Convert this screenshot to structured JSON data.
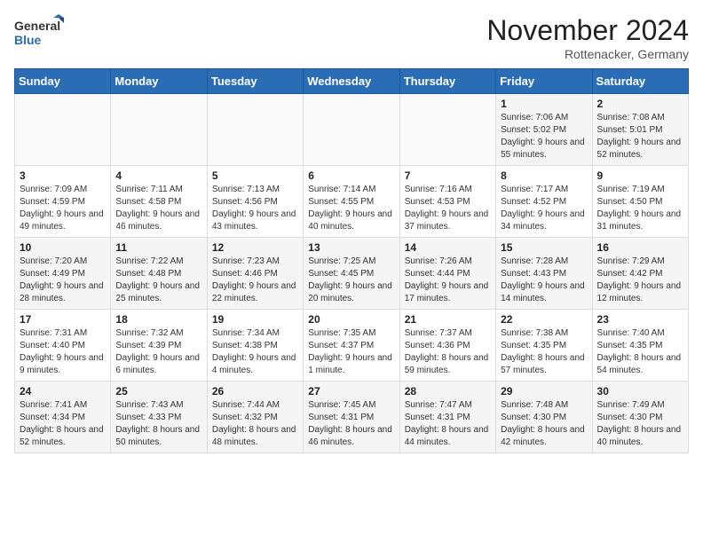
{
  "logo": {
    "general": "General",
    "blue": "Blue"
  },
  "title": "November 2024",
  "location": "Rottenacker, Germany",
  "days_header": [
    "Sunday",
    "Monday",
    "Tuesday",
    "Wednesday",
    "Thursday",
    "Friday",
    "Saturday"
  ],
  "weeks": [
    [
      {
        "day": "",
        "info": ""
      },
      {
        "day": "",
        "info": ""
      },
      {
        "day": "",
        "info": ""
      },
      {
        "day": "",
        "info": ""
      },
      {
        "day": "",
        "info": ""
      },
      {
        "day": "1",
        "info": "Sunrise: 7:06 AM\nSunset: 5:02 PM\nDaylight: 9 hours and 55 minutes."
      },
      {
        "day": "2",
        "info": "Sunrise: 7:08 AM\nSunset: 5:01 PM\nDaylight: 9 hours and 52 minutes."
      }
    ],
    [
      {
        "day": "3",
        "info": "Sunrise: 7:09 AM\nSunset: 4:59 PM\nDaylight: 9 hours and 49 minutes."
      },
      {
        "day": "4",
        "info": "Sunrise: 7:11 AM\nSunset: 4:58 PM\nDaylight: 9 hours and 46 minutes."
      },
      {
        "day": "5",
        "info": "Sunrise: 7:13 AM\nSunset: 4:56 PM\nDaylight: 9 hours and 43 minutes."
      },
      {
        "day": "6",
        "info": "Sunrise: 7:14 AM\nSunset: 4:55 PM\nDaylight: 9 hours and 40 minutes."
      },
      {
        "day": "7",
        "info": "Sunrise: 7:16 AM\nSunset: 4:53 PM\nDaylight: 9 hours and 37 minutes."
      },
      {
        "day": "8",
        "info": "Sunrise: 7:17 AM\nSunset: 4:52 PM\nDaylight: 9 hours and 34 minutes."
      },
      {
        "day": "9",
        "info": "Sunrise: 7:19 AM\nSunset: 4:50 PM\nDaylight: 9 hours and 31 minutes."
      }
    ],
    [
      {
        "day": "10",
        "info": "Sunrise: 7:20 AM\nSunset: 4:49 PM\nDaylight: 9 hours and 28 minutes."
      },
      {
        "day": "11",
        "info": "Sunrise: 7:22 AM\nSunset: 4:48 PM\nDaylight: 9 hours and 25 minutes."
      },
      {
        "day": "12",
        "info": "Sunrise: 7:23 AM\nSunset: 4:46 PM\nDaylight: 9 hours and 22 minutes."
      },
      {
        "day": "13",
        "info": "Sunrise: 7:25 AM\nSunset: 4:45 PM\nDaylight: 9 hours and 20 minutes."
      },
      {
        "day": "14",
        "info": "Sunrise: 7:26 AM\nSunset: 4:44 PM\nDaylight: 9 hours and 17 minutes."
      },
      {
        "day": "15",
        "info": "Sunrise: 7:28 AM\nSunset: 4:43 PM\nDaylight: 9 hours and 14 minutes."
      },
      {
        "day": "16",
        "info": "Sunrise: 7:29 AM\nSunset: 4:42 PM\nDaylight: 9 hours and 12 minutes."
      }
    ],
    [
      {
        "day": "17",
        "info": "Sunrise: 7:31 AM\nSunset: 4:40 PM\nDaylight: 9 hours and 9 minutes."
      },
      {
        "day": "18",
        "info": "Sunrise: 7:32 AM\nSunset: 4:39 PM\nDaylight: 9 hours and 6 minutes."
      },
      {
        "day": "19",
        "info": "Sunrise: 7:34 AM\nSunset: 4:38 PM\nDaylight: 9 hours and 4 minutes."
      },
      {
        "day": "20",
        "info": "Sunrise: 7:35 AM\nSunset: 4:37 PM\nDaylight: 9 hours and 1 minute."
      },
      {
        "day": "21",
        "info": "Sunrise: 7:37 AM\nSunset: 4:36 PM\nDaylight: 8 hours and 59 minutes."
      },
      {
        "day": "22",
        "info": "Sunrise: 7:38 AM\nSunset: 4:35 PM\nDaylight: 8 hours and 57 minutes."
      },
      {
        "day": "23",
        "info": "Sunrise: 7:40 AM\nSunset: 4:35 PM\nDaylight: 8 hours and 54 minutes."
      }
    ],
    [
      {
        "day": "24",
        "info": "Sunrise: 7:41 AM\nSunset: 4:34 PM\nDaylight: 8 hours and 52 minutes."
      },
      {
        "day": "25",
        "info": "Sunrise: 7:43 AM\nSunset: 4:33 PM\nDaylight: 8 hours and 50 minutes."
      },
      {
        "day": "26",
        "info": "Sunrise: 7:44 AM\nSunset: 4:32 PM\nDaylight: 8 hours and 48 minutes."
      },
      {
        "day": "27",
        "info": "Sunrise: 7:45 AM\nSunset: 4:31 PM\nDaylight: 8 hours and 46 minutes."
      },
      {
        "day": "28",
        "info": "Sunrise: 7:47 AM\nSunset: 4:31 PM\nDaylight: 8 hours and 44 minutes."
      },
      {
        "day": "29",
        "info": "Sunrise: 7:48 AM\nSunset: 4:30 PM\nDaylight: 8 hours and 42 minutes."
      },
      {
        "day": "30",
        "info": "Sunrise: 7:49 AM\nSunset: 4:30 PM\nDaylight: 8 hours and 40 minutes."
      }
    ]
  ]
}
